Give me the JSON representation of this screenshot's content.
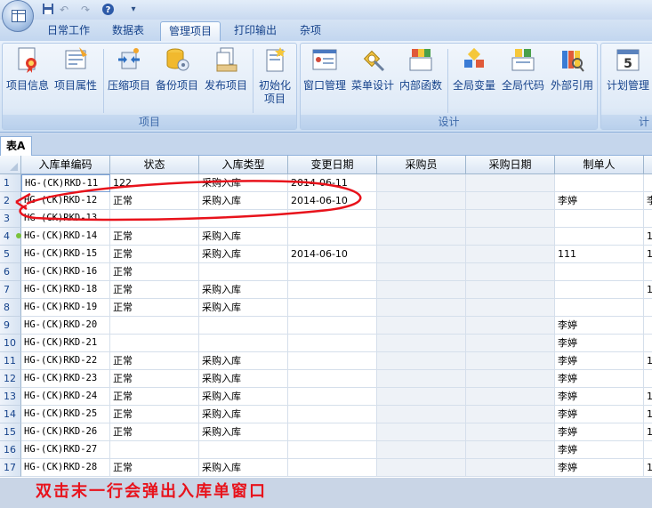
{
  "quick_access": {
    "icons": [
      "save-icon",
      "undo-icon",
      "redo-icon",
      "help-icon",
      "customize-icon"
    ]
  },
  "tabs": [
    {
      "label": "日常工作",
      "active": false
    },
    {
      "label": "数据表",
      "active": false
    },
    {
      "label": "管理项目",
      "active": true
    },
    {
      "label": "打印输出",
      "active": false
    },
    {
      "label": "杂项",
      "active": false
    }
  ],
  "ribbon": {
    "groups": [
      {
        "label": "项目",
        "buttons": [
          {
            "label": "项目信息",
            "icon": "project-info-icon"
          },
          {
            "label": "项目属性",
            "icon": "project-properties-icon"
          },
          {
            "label": "压缩项目",
            "icon": "compress-project-icon"
          },
          {
            "label": "备份项目",
            "icon": "backup-project-icon"
          },
          {
            "label": "发布项目",
            "icon": "publish-project-icon"
          },
          {
            "label": "初始化",
            "label2": "项目",
            "icon": "initialize-project-icon"
          }
        ]
      },
      {
        "label": "设计",
        "buttons": [
          {
            "label": "窗口管理",
            "icon": "window-management-icon"
          },
          {
            "label": "菜单设计",
            "icon": "menu-design-icon"
          },
          {
            "label": "内部函数",
            "icon": "internal-functions-icon"
          },
          {
            "label": "全局变量",
            "icon": "global-variables-icon"
          },
          {
            "label": "全局代码",
            "icon": "global-code-icon"
          },
          {
            "label": "外部引用",
            "icon": "external-references-icon"
          }
        ]
      },
      {
        "label": "计",
        "buttons": [
          {
            "label": "计划管理",
            "icon": "schedule-management-icon"
          }
        ]
      }
    ]
  },
  "sheet": {
    "tab_label": "表A",
    "columns": [
      "入库单编码",
      "状态",
      "入库类型",
      "变更日期",
      "采购员",
      "采购日期",
      "制单人"
    ],
    "rows": [
      {
        "n": "1",
        "cells": [
          "HG-(CK)RKD-11",
          "122",
          "采购入库",
          "2014-06-11",
          "",
          "",
          "",
          ""
        ]
      },
      {
        "n": "2",
        "cells": [
          "HG-(CK)RKD-12",
          "正常",
          "采购入库",
          "2014-06-10",
          "",
          "",
          "李婷",
          "李"
        ]
      },
      {
        "n": "3",
        "cells": [
          "HG-(CK)RKD-13",
          "",
          "",
          "",
          "",
          "",
          "",
          ""
        ]
      },
      {
        "n": "4",
        "cells": [
          "HG-(CK)RKD-14",
          "正常",
          "采购入库",
          "",
          "",
          "",
          "",
          "1"
        ]
      },
      {
        "n": "5",
        "cells": [
          "HG-(CK)RKD-15",
          "正常",
          "采购入库",
          "2014-06-10",
          "",
          "",
          "111",
          "1"
        ]
      },
      {
        "n": "6",
        "cells": [
          "HG-(CK)RKD-16",
          "正常",
          "",
          "",
          "",
          "",
          "",
          ""
        ]
      },
      {
        "n": "7",
        "cells": [
          "HG-(CK)RKD-18",
          "正常",
          "采购入库",
          "",
          "",
          "",
          "",
          "1"
        ]
      },
      {
        "n": "8",
        "cells": [
          "HG-(CK)RKD-19",
          "正常",
          "采购入库",
          "",
          "",
          "",
          "",
          ""
        ]
      },
      {
        "n": "9",
        "cells": [
          "HG-(CK)RKD-20",
          "",
          "",
          "",
          "",
          "",
          "李婷",
          ""
        ]
      },
      {
        "n": "10",
        "cells": [
          "HG-(CK)RKD-21",
          "",
          "",
          "",
          "",
          "",
          "李婷",
          ""
        ]
      },
      {
        "n": "11",
        "cells": [
          "HG-(CK)RKD-22",
          "正常",
          "采购入库",
          "",
          "",
          "",
          "李婷",
          "1"
        ]
      },
      {
        "n": "12",
        "cells": [
          "HG-(CK)RKD-23",
          "正常",
          "采购入库",
          "",
          "",
          "",
          "李婷",
          ""
        ]
      },
      {
        "n": "13",
        "cells": [
          "HG-(CK)RKD-24",
          "正常",
          "采购入库",
          "",
          "",
          "",
          "李婷",
          "1"
        ]
      },
      {
        "n": "14",
        "cells": [
          "HG-(CK)RKD-25",
          "正常",
          "采购入库",
          "",
          "",
          "",
          "李婷",
          "1"
        ]
      },
      {
        "n": "15",
        "cells": [
          "HG-(CK)RKD-26",
          "正常",
          "采购入库",
          "",
          "",
          "",
          "李婷",
          "1"
        ]
      },
      {
        "n": "16",
        "cells": [
          "HG-(CK)RKD-27",
          "",
          "",
          "",
          "",
          "",
          "李婷",
          ""
        ]
      },
      {
        "n": "17",
        "cells": [
          "HG-(CK)RKD-28",
          "正常",
          "采购入库",
          "",
          "",
          "",
          "李婷",
          "1"
        ]
      }
    ]
  },
  "annotation": {
    "caption": "双击末一行会弹出入库单窗口",
    "color": "#e8121b"
  }
}
